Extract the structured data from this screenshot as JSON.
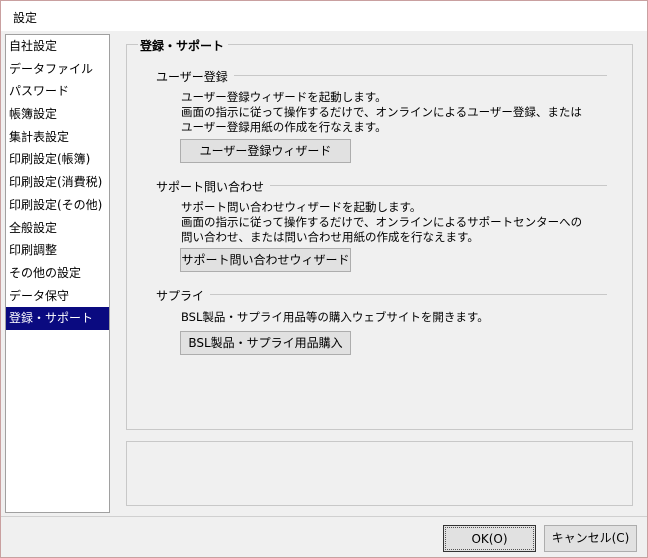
{
  "window": {
    "title": "設定"
  },
  "sidebar": {
    "items": [
      {
        "label": "自社設定"
      },
      {
        "label": "データファイル"
      },
      {
        "label": "パスワード"
      },
      {
        "label": "帳簿設定"
      },
      {
        "label": "集計表設定"
      },
      {
        "label": "印刷設定(帳簿)"
      },
      {
        "label": "印刷設定(消費税)"
      },
      {
        "label": "印刷設定(その他)"
      },
      {
        "label": "全般設定"
      },
      {
        "label": "印刷調整"
      },
      {
        "label": "その他の設定"
      },
      {
        "label": "データ保守"
      },
      {
        "label": "登録・サポート"
      }
    ],
    "selected_index": 12
  },
  "main": {
    "group_title": "登録・サポート",
    "user_registration": {
      "heading": "ユーザー登録",
      "desc_lines": [
        "ユーザー登録ウィザードを起動します。",
        "画面の指示に従って操作するだけで、オンラインによるユーザー登録、または",
        "ユーザー登録用紙の作成を行なえます。"
      ],
      "button_label": "ユーザー登録ウィザード"
    },
    "support_inquiry": {
      "heading": "サポート問い合わせ",
      "desc_lines": [
        "サポート問い合わせウィザードを起動します。",
        "画面の指示に従って操作するだけで、オンラインによるサポートセンターへの",
        "問い合わせ、または問い合わせ用紙の作成を行なえます。"
      ],
      "button_label": "サポート問い合わせウィザード"
    },
    "supply": {
      "heading": "サプライ",
      "desc_lines": [
        "BSL製品・サプライ用品等の購入ウェブサイトを開きます。"
      ],
      "button_label": "BSL製品・サプライ用品購入"
    }
  },
  "footer": {
    "ok_label": "OK(O)",
    "cancel_label": "キャンセル(C)"
  },
  "colors": {
    "selection": "#0a0a80",
    "window_bg": "#f0f0f0"
  }
}
